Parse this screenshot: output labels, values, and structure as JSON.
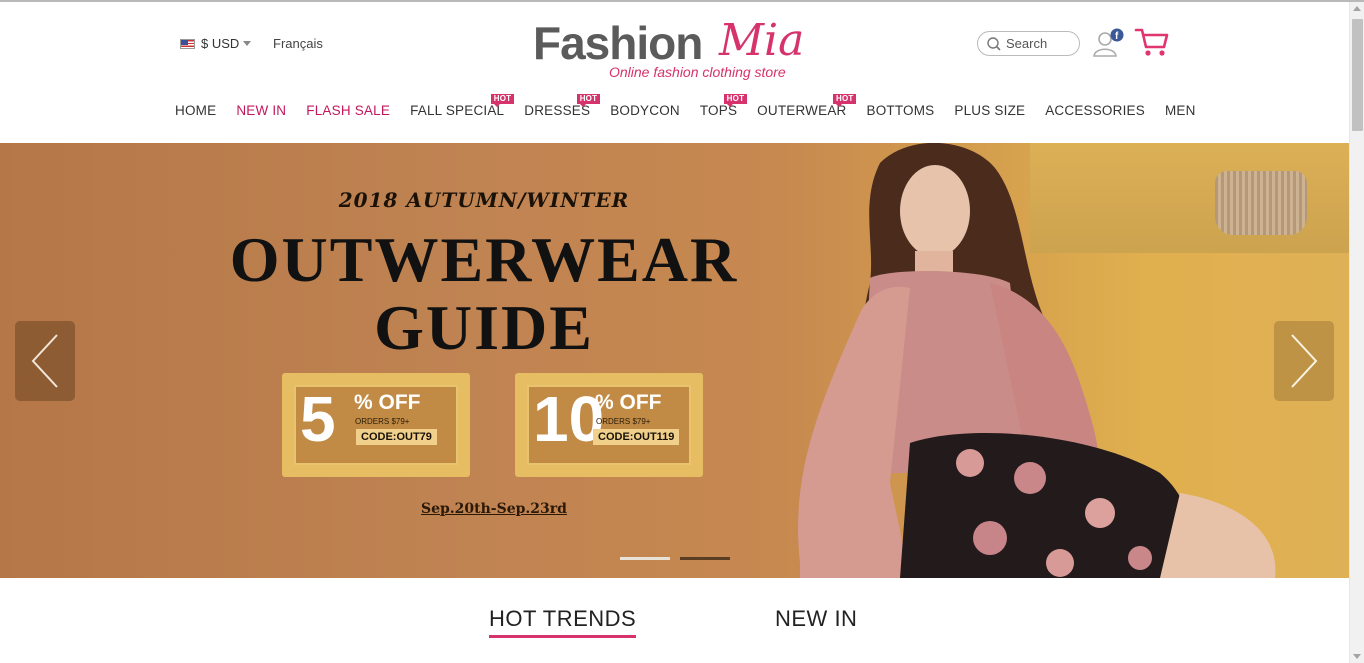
{
  "header": {
    "currency": "$ USD",
    "language": "Français",
    "logo_text_main": "Fashion",
    "logo_text_accent": "Mia",
    "logo_tagline": "Online fashion clothing store",
    "search_placeholder": "Search",
    "accent_color": "#d6336c"
  },
  "nav": {
    "items": [
      {
        "label": "HOME",
        "highlight": false,
        "hot": false
      },
      {
        "label": "NEW IN",
        "highlight": true,
        "hot": false
      },
      {
        "label": "FLASH SALE",
        "highlight": true,
        "hot": false
      },
      {
        "label": "FALL SPECIAL",
        "highlight": false,
        "hot": true
      },
      {
        "label": "DRESSES",
        "highlight": false,
        "hot": true
      },
      {
        "label": "BODYCON",
        "highlight": false,
        "hot": false
      },
      {
        "label": "TOPS",
        "highlight": false,
        "hot": true
      },
      {
        "label": "OUTERWEAR",
        "highlight": false,
        "hot": true
      },
      {
        "label": "BOTTOMS",
        "highlight": false,
        "hot": false
      },
      {
        "label": "PLUS SIZE",
        "highlight": false,
        "hot": false
      },
      {
        "label": "ACCESSORIES",
        "highlight": false,
        "hot": false
      },
      {
        "label": "MEN",
        "highlight": false,
        "hot": false
      }
    ],
    "hot_badge": "HOT"
  },
  "banner": {
    "subtitle": "2018 AUTUMN/WINTER",
    "title_line1": "OUTWERWEAR",
    "title_line2": "GUIDE",
    "coupons": [
      {
        "amount": "5",
        "off": "% OFF",
        "orders": "ORDERS $79+",
        "code": "CODE:OUT79"
      },
      {
        "amount": "10",
        "off": "% OFF",
        "orders": "ORDERS $79+",
        "code": "CODE:OUT119"
      }
    ],
    "dates": "Sep.20th-Sep.23rd",
    "slide_count": 2,
    "active_slide": 1
  },
  "tabs": [
    {
      "label": "HOT TRENDS",
      "active": true
    },
    {
      "label": "NEW IN",
      "active": false
    }
  ]
}
